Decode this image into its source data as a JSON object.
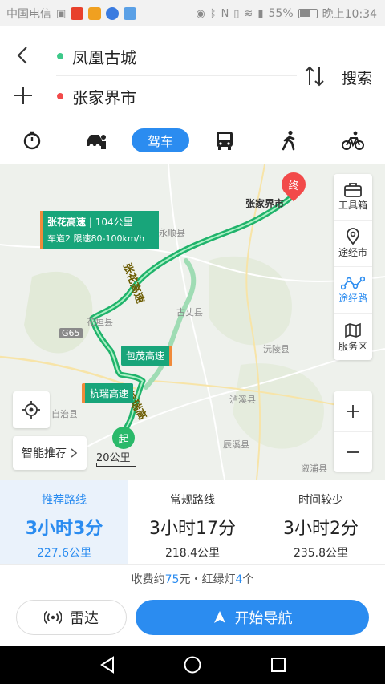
{
  "status_bar": {
    "carrier": "中国电信",
    "battery": "55%",
    "time": "晚上10:34"
  },
  "header": {
    "origin": "凤凰古城",
    "destination": "张家界市",
    "search_label": "搜索"
  },
  "modes": {
    "active_label": "驾车",
    "icons": [
      "timer-icon",
      "taxi-icon",
      "car-drive",
      "bus-icon",
      "walk-icon",
      "bike-icon"
    ]
  },
  "map": {
    "places": {
      "yongshun": "永顺县",
      "guzhang": "古丈县",
      "huayuan": "花垣县",
      "luxi": "泸溪县",
      "yuanling": "沅陵县",
      "chenxi": "辰溪县",
      "xupu": "溆浦县",
      "zizhi": "自治县",
      "g65": "G65",
      "zhangjiajie": "张家界市"
    },
    "highway_big": {
      "name": "张花高速",
      "km": "104公里",
      "detail": "车道2 限速80-100km/h"
    },
    "highway_baomao": "包茂高速",
    "highway_hangrui": "杭瑞高速",
    "road_text_zhanghua": "张花高速",
    "road_text_hangrui": "杭瑞高",
    "start_label": "起",
    "end_label": "终",
    "scale": "20公里",
    "smart_label": "智能推荐",
    "tools": [
      {
        "label": "工具箱",
        "icon": "toolbox-icon"
      },
      {
        "label": "途经市",
        "icon": "location-pin-icon"
      },
      {
        "label": "途经路",
        "icon": "route-icon"
      },
      {
        "label": "服务区",
        "icon": "map-flag-icon"
      }
    ],
    "colors": {
      "route": "#1fb36b",
      "alt_route": "#9fdcb4",
      "accent": "#2b8cf0"
    }
  },
  "routes": [
    {
      "label": "推荐路线",
      "time": "3小时3分",
      "dist": "227.6公里",
      "active": true
    },
    {
      "label": "常规路线",
      "time": "3小时17分",
      "dist": "218.4公里",
      "active": false
    },
    {
      "label": "时间较少",
      "time": "3小时2分",
      "dist": "235.8公里",
      "active": false
    }
  ],
  "fees": {
    "prefix": "收费约",
    "amount": "75",
    "mid": "元・红绿灯",
    "lights": "4",
    "suffix": "个"
  },
  "actions": {
    "radar": "雷达",
    "start_nav": "开始导航"
  }
}
